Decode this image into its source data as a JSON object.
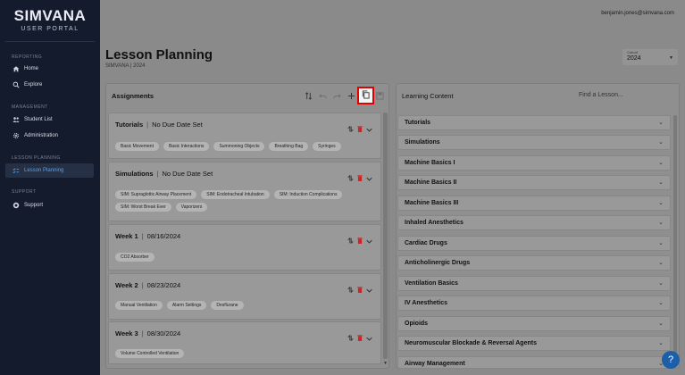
{
  "sidebar": {
    "brand": "SIMVANA",
    "subtitle": "USER PORTAL",
    "sections": {
      "reporting": "REPORTING",
      "management": "MANAGEMENT",
      "lesson_planning": "LESSON PLANNING",
      "support": "SUPPORT"
    },
    "items": {
      "home": "Home",
      "explore": "Explore",
      "student_list": "Student List",
      "administration": "Administration",
      "lesson_planning": "Lesson Planning",
      "support": "Support"
    }
  },
  "header": {
    "user_email": "benjamin.jones@simvana.com"
  },
  "page": {
    "title": "Lesson Planning",
    "subtitle": "SIMVANA | 2024",
    "cohort_label": "Cohort",
    "cohort_value": "2024"
  },
  "assignments": {
    "title": "Assignments",
    "cards": [
      {
        "name": "Tutorials",
        "due": "No Due Date Set",
        "chips": [
          "Basic Movement",
          "Basic Interactions",
          "Summoning Objects",
          "Breathing Bag",
          "Syringes"
        ]
      },
      {
        "name": "Simulations",
        "due": "No Due Date Set",
        "chips": [
          "SIM: Supraglottic Airway Placement",
          "SIM: Endotracheal Intubation",
          "SIM: Induction Complications",
          "SIM: Worst Break Ever",
          "Vaporizers"
        ]
      },
      {
        "name": "Week 1",
        "due": "08/16/2024",
        "chips": [
          "CO2 Absorber"
        ]
      },
      {
        "name": "Week 2",
        "due": "08/23/2024",
        "chips": [
          "Manual Ventilation",
          "Alarm Settings",
          "Desflurane"
        ]
      },
      {
        "name": "Week 3",
        "due": "08/30/2024",
        "chips": [
          "Volume Controlled Ventilation"
        ]
      }
    ]
  },
  "learning": {
    "title": "Learning Content",
    "search_placeholder": "Find a Lesson...",
    "items": [
      "Tutorials",
      "Simulations",
      "Machine Basics I",
      "Machine Basics II",
      "Machine Basics III",
      "Inhaled Anesthetics",
      "Cardiac Drugs",
      "Anticholinergic Drugs",
      "Ventilation Basics",
      "IV Anesthetics",
      "Opioids",
      "Neuromuscular Blockade & Reversal Agents",
      "Airway Management"
    ]
  },
  "colors": {
    "sidebar_bg": "#141b2d",
    "active_accent": "#5aa0e6",
    "highlight_border": "#e00000",
    "delete_red": "#c62828",
    "help_button": "#1c5ea8"
  },
  "icons": {
    "help": "?"
  }
}
